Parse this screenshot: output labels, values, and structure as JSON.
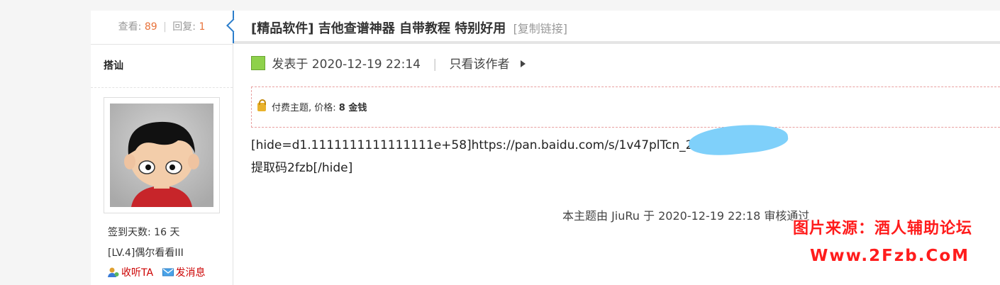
{
  "sidebar": {
    "views_label": "查看:",
    "views": "89",
    "replies_label": "回复:",
    "replies": "1",
    "separator": "|",
    "username": "搭讪",
    "checkin": "签到天数: 16 天",
    "level": "[LV.4]偶尔看看III",
    "follow_label": "收听TA",
    "message_label": "发消息"
  },
  "thread": {
    "category": "[精品软件]",
    "title": "吉他查谱神器 自带教程 特别好用",
    "copy_link": "[复制链接]",
    "posted_at": "发表于 2020-12-19 22:14",
    "author_only": "只看该作者",
    "pipe": "|"
  },
  "paywall": {
    "prefix": "付费主题, 价格:",
    "price": "8 金钱"
  },
  "post": {
    "line1": "[hide=d1.1111111111111111e+58]https://pan.baidu.com/s/1v47plTcn_2y",
    "line2": "提取码2fzb[/hide]",
    "review": "本主题由 JiuRu 于 2020-12-19 22:18 审核通过"
  },
  "watermark": {
    "line1": "图片来源：酒人辅助论坛",
    "line2": "Www.2Fzb.CoM"
  },
  "colors": {
    "accent_blue": "#2b7dcb",
    "count_orange": "#e8723a",
    "link_red": "#cc0000",
    "watermark_red": "#ff1c1c",
    "paybox_border": "#e8a0a0"
  }
}
